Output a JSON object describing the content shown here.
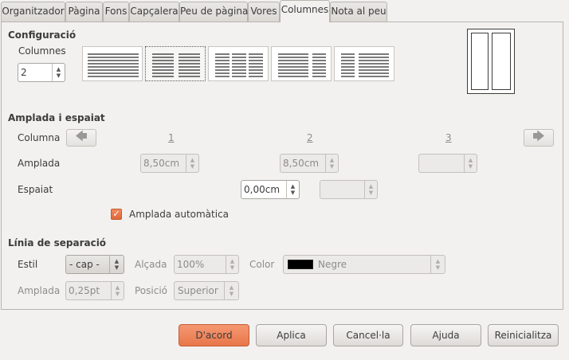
{
  "tabs": [
    {
      "label": "Organitzador",
      "active": false
    },
    {
      "label": "Pàgina",
      "active": false
    },
    {
      "label": "Fons",
      "active": false
    },
    {
      "label": "Capçalera",
      "active": false
    },
    {
      "label": "Peu de pàgina",
      "active": false
    },
    {
      "label": "Vores",
      "active": false
    },
    {
      "label": "Columnes",
      "active": true
    },
    {
      "label": "Nota al peu",
      "active": false
    }
  ],
  "config": {
    "title": "Configuració",
    "columns_label": "Columnes",
    "columns_value": "2"
  },
  "width_spacing": {
    "title": "Amplada i espaiat",
    "column_label": "Columna",
    "col_numbers": [
      "1",
      "2",
      "3"
    ],
    "width_label": "Amplada",
    "widths": [
      "8,50cm",
      "8,50cm",
      ""
    ],
    "spacing_label": "Espaiat",
    "spacings": [
      "0,00cm",
      ""
    ],
    "auto_width_label": "Amplada automàtica",
    "auto_width_checked": true
  },
  "separator": {
    "title": "Línia de separació",
    "style_label": "Estil",
    "style_value": "- cap -",
    "height_label": "Alçada",
    "height_value": "100%",
    "color_label": "Color",
    "color_value": "Negre",
    "color_hex": "#000000",
    "width_label": "Amplada",
    "width_value": "0,25pt",
    "position_label": "Posició",
    "position_value": "Superior"
  },
  "buttons": {
    "ok": "D'acord",
    "apply": "Aplica",
    "cancel": "Cancel·la",
    "help": "Ajuda",
    "reset": "Reinicialitza"
  }
}
